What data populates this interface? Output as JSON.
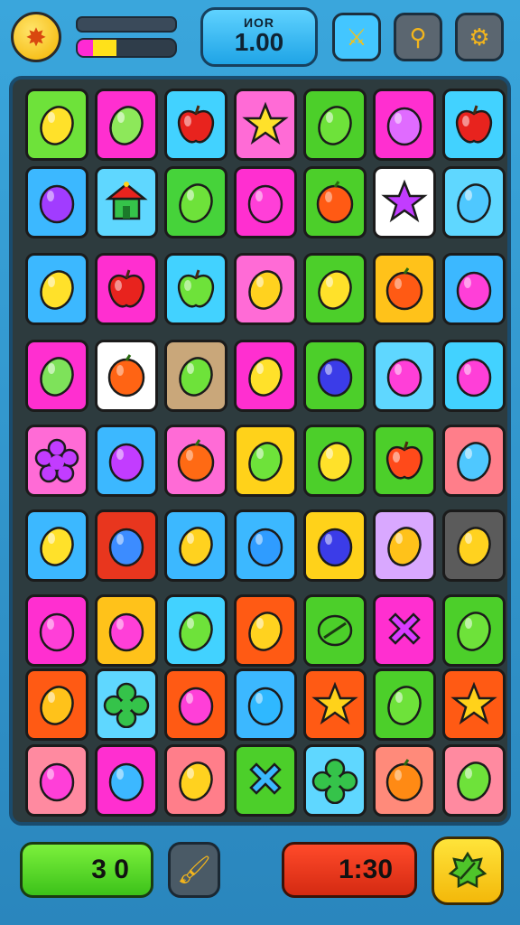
{
  "hud": {
    "score_label": "ИOR",
    "score_value": "1.00",
    "progress_fraction": 0.4,
    "star_icon": "star-icon",
    "tools": [
      {
        "name": "hammer-tool-button",
        "icon": "swords-icon",
        "color": "#43c6ff"
      },
      {
        "name": "search-tool-button",
        "icon": "magnifier-icon",
        "color": "#5b6670"
      },
      {
        "name": "settings-button",
        "icon": "gear-icon",
        "color": "#5b6670"
      }
    ]
  },
  "footer": {
    "moves_value": "3 0",
    "timer_value": "1:30",
    "brush_icon": "brush-icon",
    "leaf_icon": "leaf-icon"
  },
  "board": {
    "rows": [
      [
        [
          "#6ee23a",
          "lemon",
          "#ffe12a"
        ],
        [
          "#ff2fd0",
          "lemon",
          "#8de85a"
        ],
        [
          "#42d2ff",
          "apple",
          "#e8231e"
        ],
        [
          "#ff6bd6",
          "star",
          "#ffe12a"
        ],
        [
          "#4ccf2a",
          "lemon",
          "#6ee23a"
        ],
        [
          "#ff2fd0",
          "plum",
          "#e06bff"
        ],
        [
          "#42d2ff",
          "apple",
          "#e8231e"
        ]
      ],
      [
        [
          "#3cb8ff",
          "plum",
          "#a13cff"
        ],
        [
          "#5fd7ff",
          "carousel",
          "#35c34a"
        ],
        [
          "#46d33a",
          "lemon",
          "#6ee23a"
        ],
        [
          "#ff2fd0",
          "plum",
          "#ff3fd8"
        ],
        [
          "#4ccf2a",
          "orange",
          "#ff5a14"
        ],
        [
          "#ffffff",
          "star",
          "#c23cff"
        ],
        [
          "#5fd7ff",
          "lemon",
          "#4fc8ff"
        ]
      ],
      [
        [
          "#3cb8ff",
          "lemon",
          "#ffe12a"
        ],
        [
          "#ff2fd0",
          "apple",
          "#e8231e"
        ],
        [
          "#42d2ff",
          "apple",
          "#6ee23a"
        ],
        [
          "#ff6bd6",
          "lemon",
          "#ffd21f"
        ],
        [
          "#4ccf2a",
          "lemon",
          "#ffe12a"
        ],
        [
          "#ffc21a",
          "orange",
          "#ff5a14"
        ],
        [
          "#3cb8ff",
          "plum",
          "#ff3fd8"
        ]
      ],
      [
        [
          "#ff2fd0",
          "lemon",
          "#7ee25a"
        ],
        [
          "#ffffff",
          "orange",
          "#ff6414"
        ],
        [
          "#c9a77a",
          "lemon",
          "#6ee23a"
        ],
        [
          "#ff2fd0",
          "lemon",
          "#ffe12a"
        ],
        [
          "#4ccf2a",
          "plum",
          "#3b3ce8"
        ],
        [
          "#5fd7ff",
          "plum",
          "#ff3fd8"
        ],
        [
          "#42d2ff",
          "plum",
          "#ff3fd8"
        ]
      ],
      [
        [
          "#ff6bd6",
          "flower",
          "#c23cff"
        ],
        [
          "#3cb8ff",
          "plum",
          "#c23cff"
        ],
        [
          "#ff6bd6",
          "orange",
          "#ff6a14"
        ],
        [
          "#ffd21a",
          "lemon",
          "#6ee23a"
        ],
        [
          "#4ccf2a",
          "lemon",
          "#ffe12a"
        ],
        [
          "#4ccf2a",
          "apple",
          "#ff4a1a"
        ],
        [
          "#ff7e8a",
          "lemon",
          "#4fc8ff"
        ]
      ],
      [
        [
          "#3cb8ff",
          "lemon",
          "#ffe12a"
        ],
        [
          "#e8361e",
          "plum",
          "#3c8cff"
        ],
        [
          "#3cb8ff",
          "lemon",
          "#ffd21f"
        ],
        [
          "#3cb8ff",
          "plum",
          "#2f9cff"
        ],
        [
          "#ffd21a",
          "plum",
          "#3b3ce8"
        ],
        [
          "#d9a8ff",
          "lemon",
          "#ffc21a"
        ],
        [
          "#5b5b5b",
          "lemon",
          "#ffd21f"
        ]
      ],
      [
        [
          "#ff2fd0",
          "plum",
          "#ff3fd8"
        ],
        [
          "#ffc21a",
          "plum",
          "#ff3fd8"
        ],
        [
          "#42d2ff",
          "lemon",
          "#6ee23a"
        ],
        [
          "#ff5a14",
          "lemon",
          "#ffd21f"
        ],
        [
          "#4ccf2a",
          "candy",
          "#4ccf2a"
        ],
        [
          "#ff2fd0",
          "cross",
          "#d83cff"
        ],
        [
          "#4ccf2a",
          "lemon",
          "#6ee23a"
        ]
      ],
      [
        [
          "#ff5a14",
          "lemon",
          "#ffc21a"
        ],
        [
          "#5fd7ff",
          "clover",
          "#35c34a"
        ],
        [
          "#ff5a14",
          "plum",
          "#ff3fd8"
        ],
        [
          "#3cb8ff",
          "plum",
          "#2fb8ff"
        ],
        [
          "#ff5a14",
          "star",
          "#ffd21a"
        ],
        [
          "#4ccf2a",
          "lemon",
          "#6ee23a"
        ],
        [
          "#ff5a14",
          "star",
          "#ffd21a"
        ]
      ],
      [
        [
          "#ff8aa0",
          "plum",
          "#ff3fd8"
        ],
        [
          "#ff2fd0",
          "plum",
          "#3cb8ff"
        ],
        [
          "#ff7e8a",
          "lemon",
          "#ffd21f"
        ],
        [
          "#4ccf2a",
          "cross",
          "#3cb8ff"
        ],
        [
          "#5fd7ff",
          "clover",
          "#35c34a"
        ],
        [
          "#ff8a7a",
          "orange",
          "#ff8a14"
        ],
        [
          "#ff8aa0",
          "lemon",
          "#6ee23a"
        ]
      ]
    ]
  }
}
